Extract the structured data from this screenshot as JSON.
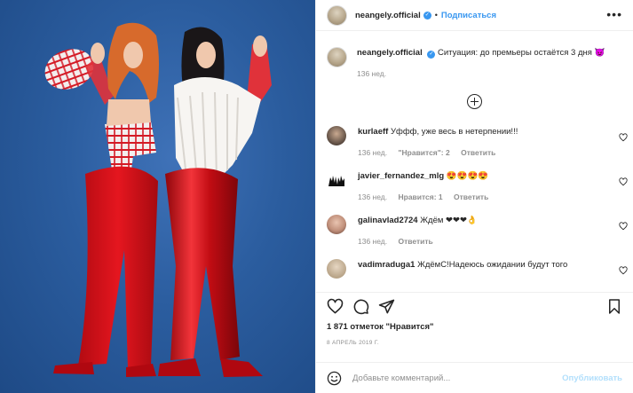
{
  "post": {
    "author": "neangely.official",
    "follow_label": "Подписаться",
    "more_label": "•••",
    "caption_text": "Ситуация: до премьеры остаётся 3 дня 😈",
    "caption_age": "136 нед."
  },
  "comments": [
    {
      "user": "kurlaeff",
      "text": "Уффф, уже весь в нетерпении!!!",
      "age": "136 нед.",
      "likes": "\"Нравится\": 2",
      "reply": "Ответить"
    },
    {
      "user": "javier_fernandez_mlg",
      "text": "😍😍😍😍",
      "age": "136 нед.",
      "likes": "Нравится: 1",
      "reply": "Ответить"
    },
    {
      "user": "galinavlad2724",
      "text": "Ждём ❤❤❤👌",
      "age": "136 нед.",
      "likes": "",
      "reply": "Ответить"
    },
    {
      "user": "vadimraduga1",
      "text": "ЖдёмС!Надеюсь ожидании будут того",
      "age": "",
      "likes": "",
      "reply": ""
    }
  ],
  "stats": {
    "likes": "1 871 отметок \"Нравится\"",
    "date": "8 АПРЕЛЬ 2019 Г."
  },
  "add_comment": {
    "placeholder": "Добавьте комментарий...",
    "publish_label": "Опубликовать"
  },
  "icons": {
    "verified": "verified-badge-icon",
    "like": "heart-icon",
    "comment": "comment-icon",
    "share": "share-icon",
    "save": "bookmark-icon",
    "emoji": "smiley-icon",
    "more_comments": "plus-circle-icon"
  },
  "colors": {
    "link_blue": "#3897f0",
    "publish_disabled": "#b2dffc",
    "meta_gray": "#8e8e8e",
    "photo_background": "#2b5d9f",
    "outfit_red": "#d8101a"
  }
}
